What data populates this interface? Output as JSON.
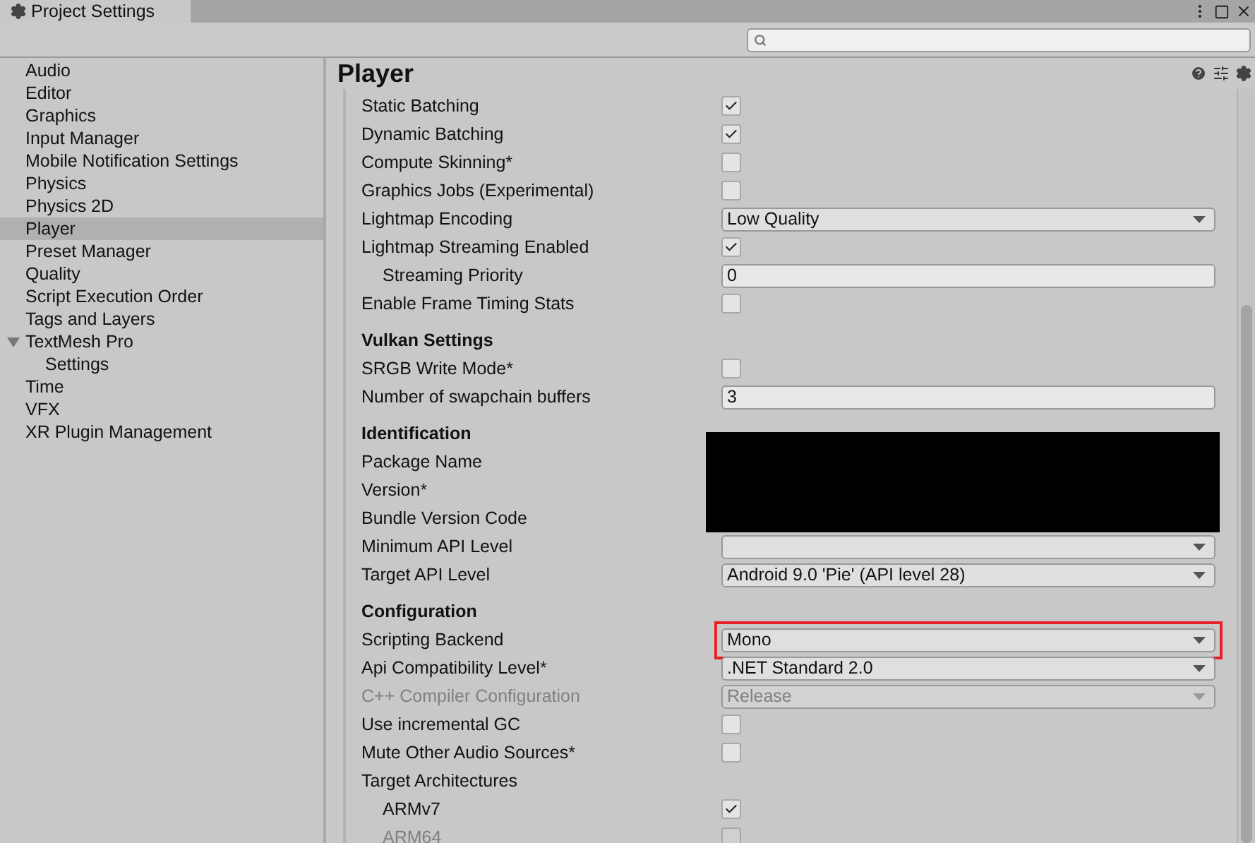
{
  "window": {
    "title": "Project Settings"
  },
  "sidebar": {
    "items": [
      {
        "label": "Audio",
        "selected": false
      },
      {
        "label": "Editor",
        "selected": false
      },
      {
        "label": "Graphics",
        "selected": false
      },
      {
        "label": "Input Manager",
        "selected": false
      },
      {
        "label": "Mobile Notification Settings",
        "selected": false
      },
      {
        "label": "Physics",
        "selected": false
      },
      {
        "label": "Physics 2D",
        "selected": false
      },
      {
        "label": "Player",
        "selected": true
      },
      {
        "label": "Preset Manager",
        "selected": false
      },
      {
        "label": "Quality",
        "selected": false
      },
      {
        "label": "Script Execution Order",
        "selected": false
      },
      {
        "label": "Tags and Layers",
        "selected": false
      },
      {
        "label": "TextMesh Pro",
        "selected": false,
        "expanded": true,
        "children": [
          {
            "label": "Settings",
            "selected": false
          }
        ]
      },
      {
        "label": "Time",
        "selected": false
      },
      {
        "label": "VFX",
        "selected": false
      },
      {
        "label": "XR Plugin Management",
        "selected": false
      }
    ]
  },
  "panel": {
    "title": "Player",
    "rows": [
      {
        "kind": "checkbox",
        "label": "Static Batching",
        "checked": true
      },
      {
        "kind": "checkbox",
        "label": "Dynamic Batching",
        "checked": true
      },
      {
        "kind": "checkbox",
        "label": "Compute Skinning*",
        "checked": false
      },
      {
        "kind": "checkbox",
        "label": "Graphics Jobs (Experimental)",
        "checked": false
      },
      {
        "kind": "dropdown",
        "label": "Lightmap Encoding",
        "value": "Low Quality"
      },
      {
        "kind": "checkbox",
        "label": "Lightmap Streaming Enabled",
        "checked": true
      },
      {
        "kind": "field",
        "label": "Streaming Priority",
        "value": "0",
        "indented": true
      },
      {
        "kind": "checkbox",
        "label": "Enable Frame Timing Stats",
        "checked": false
      },
      {
        "kind": "heading",
        "label": "Vulkan Settings"
      },
      {
        "kind": "checkbox",
        "label": "SRGB Write Mode*",
        "checked": false
      },
      {
        "kind": "field",
        "label": "Number of swapchain buffers",
        "value": "3"
      },
      {
        "kind": "heading",
        "label": "Identification"
      },
      {
        "kind": "redacted",
        "label": "Package Name"
      },
      {
        "kind": "redacted",
        "label": "Version*"
      },
      {
        "kind": "redacted",
        "label": "Bundle Version Code"
      },
      {
        "kind": "dropdown",
        "label": "Minimum API Level"
      },
      {
        "kind": "dropdown",
        "label": "Target API Level",
        "value": "Android 9.0 'Pie' (API level 28)"
      },
      {
        "kind": "heading",
        "label": "Configuration"
      },
      {
        "kind": "dropdown",
        "label": "Scripting Backend",
        "value": "Mono",
        "highlighted": true
      },
      {
        "kind": "dropdown",
        "label": "Api Compatibility Level*",
        "value": ".NET Standard 2.0"
      },
      {
        "kind": "dropdown",
        "label": "C++ Compiler Configuration",
        "value": "Release",
        "disabled": true
      },
      {
        "kind": "checkbox",
        "label": "Use incremental GC",
        "checked": false
      },
      {
        "kind": "checkbox",
        "label": "Mute Other Audio Sources*",
        "checked": false
      },
      {
        "kind": "label",
        "label": "Target Architectures"
      },
      {
        "kind": "checkbox",
        "label": "ARMv7",
        "checked": true,
        "indented": true
      },
      {
        "kind": "checkbox",
        "label": "ARM64",
        "checked": false,
        "indented": true,
        "disabled": true
      }
    ]
  }
}
